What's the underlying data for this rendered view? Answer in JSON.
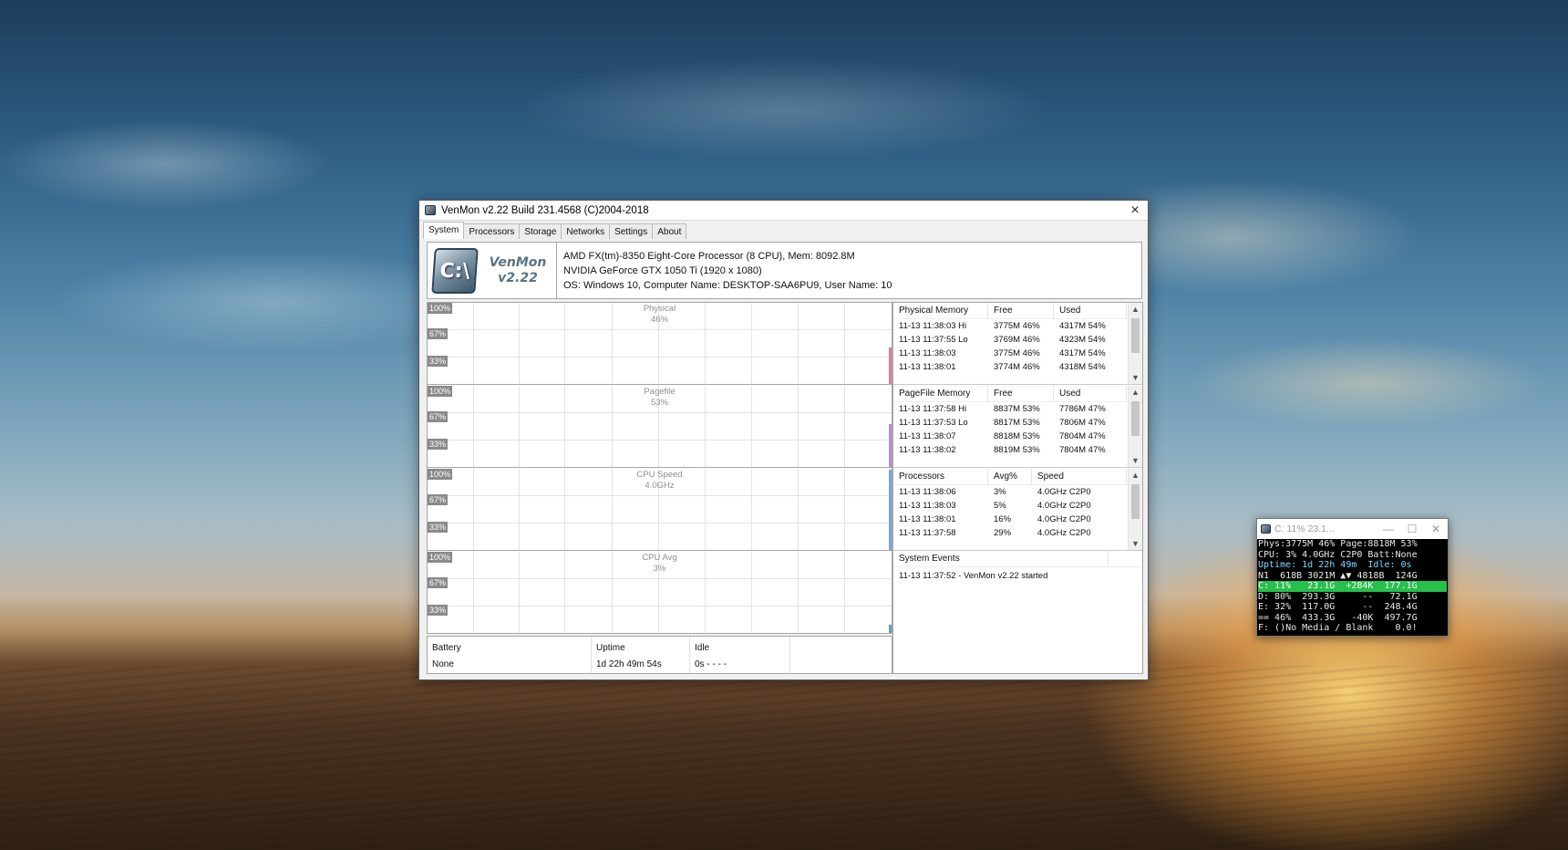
{
  "main_window": {
    "title": "VenMon v2.22 Build 231.4568 (C)2004-2018",
    "close_icon": "×",
    "tabs": [
      "System",
      "Processors",
      "Storage",
      "Networks",
      "Settings",
      "About"
    ],
    "active_tab": "System",
    "logo": {
      "icon_text": "C:\\",
      "name_line1": "VenMon",
      "name_line2": "v2.22"
    },
    "sysinfo": [
      "AMD FX(tm)-8350 Eight-Core Processor (8 CPU), Mem: 8092.8M",
      "NVIDIA GeForce GTX 1050 Ti (1920 x 1080)",
      "OS: Windows 10, Computer Name: DESKTOP-SAA6PU9, User Name: 10"
    ],
    "graphs": [
      {
        "title": "Physical",
        "value": "46%",
        "ticks": [
          "100%",
          "67%",
          "33%"
        ],
        "color": "#e27aa0",
        "level": 0.46
      },
      {
        "title": "Pagefile",
        "value": "53%",
        "ticks": [
          "100%",
          "67%",
          "33%"
        ],
        "color": "#b78ad6",
        "level": 0.53
      },
      {
        "title": "CPU Speed",
        "value": "4.0GHz",
        "ticks": [
          "100%",
          "67%",
          "33%"
        ],
        "color": "#7aa2e2",
        "level": 1.0
      },
      {
        "title": "CPU Avg",
        "value": "3%",
        "ticks": [
          "100%",
          "67%",
          "33%"
        ],
        "color": "#5aa3b3",
        "level": 0.1
      }
    ],
    "status": {
      "battery_label": "Battery",
      "battery_value": "None",
      "uptime_label": "Uptime",
      "uptime_value": "1d 22h 49m 54s",
      "idle_label": "Idle",
      "idle_value": "0s - - - -"
    },
    "physical_memory": {
      "headers": [
        "Physical Memory",
        "Free",
        "Used"
      ],
      "rows": [
        [
          "11-13  11:38:03  Hi",
          "3775M 46%",
          "4317M 54%"
        ],
        [
          "11-13  11:37:55  Lo",
          "3769M 46%",
          "4323M 54%"
        ],
        [
          "11-13  11:38:03",
          "3775M 46%",
          "4317M 54%"
        ],
        [
          "11-13  11:38:01",
          "3774M 46%",
          "4318M 54%"
        ]
      ]
    },
    "pagefile_memory": {
      "headers": [
        "PageFile Memory",
        "Free",
        "Used"
      ],
      "rows": [
        [
          "11-13  11:37:58  Hi",
          "8837M 53%",
          "7786M 47%"
        ],
        [
          "11-13  11:37:53  Lo",
          "8817M 53%",
          "7806M 47%"
        ],
        [
          "11-13  11:38:07",
          "8818M 53%",
          "7804M 47%"
        ],
        [
          "11-13  11:38:02",
          "8819M 53%",
          "7804M 47%"
        ]
      ]
    },
    "processors": {
      "headers": [
        "Processors",
        "Avg%",
        "Speed"
      ],
      "rows": [
        [
          "11-13  11:38:06",
          "3%",
          "4.0GHz C2P0"
        ],
        [
          "11-13  11:38:03",
          "5%",
          "4.0GHz C2P0"
        ],
        [
          "11-13  11:38:01",
          "16%",
          "4.0GHz C2P0"
        ],
        [
          "11-13  11:37:58",
          "29%",
          "4.0GHz C2P0"
        ]
      ]
    },
    "events": {
      "header": "System Events",
      "rows": [
        "11-13  11:37:52 - VenMon v2.22 started"
      ]
    }
  },
  "mini_window": {
    "title": "C: 11% 23.1...",
    "min_icon": "—",
    "max_icon": "☐",
    "close_icon": "✕",
    "lines": [
      "Phys:3775M 46% Page:8818M 53%",
      "CPU: 3% 4.0GHz C2P0 Batt:None",
      "Uptime: 1d 22h 49m  Idle: 0s",
      "N1  618B 3021M ▲▼ 4818B  124G",
      "C: 11%   23.1G  +284K  177.1G",
      "D: 80%  293.3G     --   72.1G",
      "E: 32%  117.0G     --  248.4G",
      "== 46%  433.3G   -40K  497.7G",
      "F: ()No Media / Blank    0.0!"
    ]
  }
}
